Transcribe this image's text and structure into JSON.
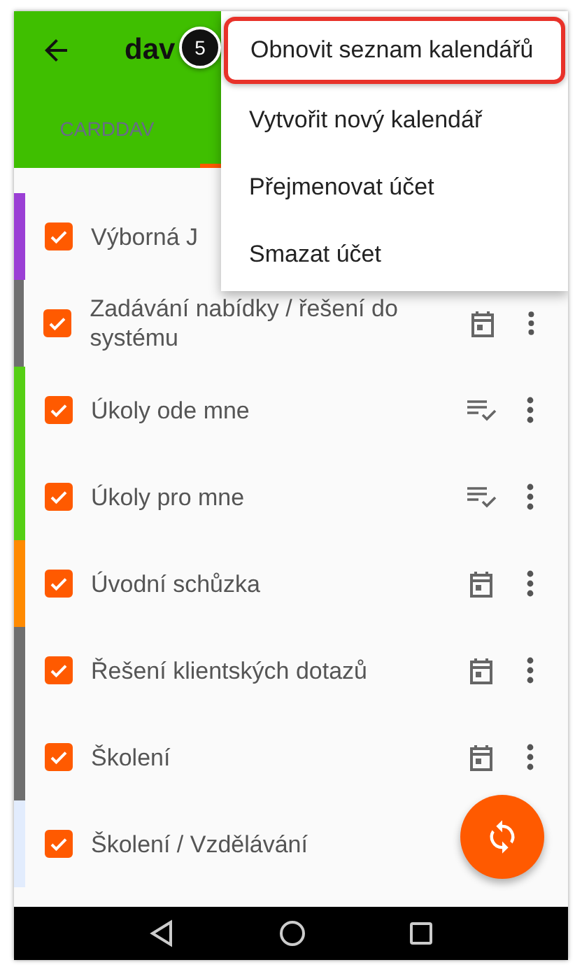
{
  "toolbar": {
    "title": "dav"
  },
  "tabs": [
    {
      "label": "CARDDAV",
      "selected": false
    },
    {
      "selected": true
    }
  ],
  "rows": [
    {
      "name": "Výborná J",
      "checked": true,
      "color": "#9b3fd5",
      "kind": "none"
    },
    {
      "name": "Zadávání nabídky / řešení do systému",
      "checked": true,
      "color": "#6f6f6f",
      "kind": "calendar"
    },
    {
      "name": "Úkoly ode mne",
      "checked": true,
      "color": "#55cf14",
      "kind": "tasks"
    },
    {
      "name": "Úkoly pro mne",
      "checked": true,
      "color": "#55cf14",
      "kind": "tasks"
    },
    {
      "name": "Úvodní schůzka",
      "checked": true,
      "color": "#ff8a00",
      "kind": "calendar"
    },
    {
      "name": "Řešení klientských dotazů",
      "checked": true,
      "color": "#6f6f6f",
      "kind": "calendar"
    },
    {
      "name": "Školení",
      "checked": true,
      "color": "#6f6f6f",
      "kind": "calendar"
    },
    {
      "name": "Školení / Vzdělávání",
      "checked": true,
      "color": "#e2ecfd",
      "kind": "none"
    }
  ],
  "menu": {
    "items": [
      {
        "label": "Obnovit seznam kalendářů",
        "highlighted": true
      },
      {
        "label": "Vytvořit nový kalendář",
        "highlighted": false
      },
      {
        "label": "Přejmenovat účet",
        "highlighted": false
      },
      {
        "label": "Smazat účet",
        "highlighted": false
      }
    ]
  },
  "step_badge": "5"
}
